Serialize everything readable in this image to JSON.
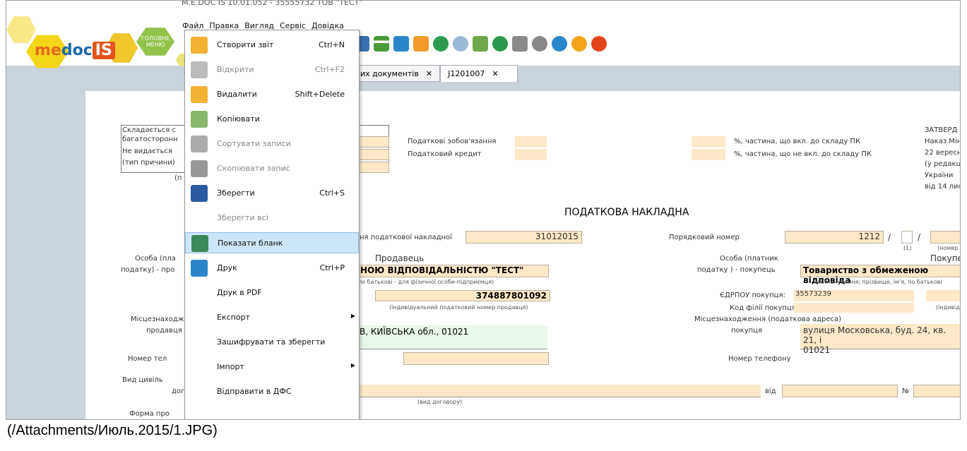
{
  "window": {
    "title": "M.E.DOC IS 10.01.052 - 35555732 ТОВ \"ТЕСТ\""
  },
  "menubar": [
    "Файл",
    "Правка",
    "Вигляд",
    "Сервіс",
    "Довідка"
  ],
  "logo": {
    "part1": "me",
    "part2": "doc",
    "part3": "IS"
  },
  "home_button": {
    "line1": "ГОЛОВНЕ",
    "line2": "МЕНЮ"
  },
  "tabs": [
    {
      "label": "их документів",
      "close": "✕"
    },
    {
      "label": "J1201007",
      "close": "✕"
    }
  ],
  "file_menu": [
    {
      "label": "Створити звіт",
      "shortcut": "Ctrl+N",
      "icon": "create-report-icon",
      "disabled": false
    },
    {
      "label": "Відкрити",
      "shortcut": "Ctrl+F2",
      "icon": "open-folder-icon",
      "disabled": true
    },
    {
      "label": "Видалити",
      "shortcut": "Shift+Delete",
      "icon": "delete-folder-icon",
      "disabled": false
    },
    {
      "label": "Копіювати",
      "shortcut": "",
      "icon": "copy-icon",
      "disabled": false
    },
    {
      "label": "Сортувати записи",
      "shortcut": "",
      "icon": "sort-icon",
      "disabled": true
    },
    {
      "label": "Скопіювати запис",
      "shortcut": "",
      "icon": "copy-record-icon",
      "disabled": true
    },
    {
      "label": "Зберегти",
      "shortcut": "Ctrl+S",
      "icon": "save-icon",
      "disabled": false
    },
    {
      "label": "Зберегти всі",
      "shortcut": "",
      "icon": "",
      "disabled": true
    },
    {
      "label": "Показати бланк",
      "shortcut": "",
      "icon": "show-form-icon",
      "disabled": false,
      "highlighted": true
    },
    {
      "label": "Друк",
      "shortcut": "Ctrl+P",
      "icon": "print-icon",
      "disabled": false
    },
    {
      "label": "Друк в PDF",
      "shortcut": "",
      "icon": "",
      "disabled": false
    },
    {
      "label": "Експорт",
      "shortcut": "",
      "icon": "",
      "disabled": false,
      "submenu": true
    },
    {
      "label": "Зашифрувати та зберегти",
      "shortcut": "",
      "icon": "",
      "disabled": false
    },
    {
      "label": "Імпорт",
      "shortcut": "",
      "icon": "",
      "disabled": false,
      "submenu": true
    },
    {
      "label": "Відправити в ДФС",
      "shortcut": "",
      "icon": "",
      "disabled": false
    }
  ],
  "doc": {
    "left_box": [
      "Складається с",
      "багатосторонн",
      "Не видається",
      "(тип причини)",
      "(п"
    ],
    "tax_liab": "Податкові зобов'язання",
    "tax_credit": "Податковий кредит",
    "pct_incl": "%, частина, що вкл. до складу ПК",
    "pct_excl": "%, частина, що не вкл. до складу ПК",
    "approved": [
      "ЗАТВЕРД",
      "Наказ Мін",
      "22 вересн",
      "(у редакці",
      "України",
      "від 14 лис"
    ],
    "title": "ПОДАТКОВА НАКЛАДНА",
    "date_label": "ня податкової накладної",
    "date_value": "31012015",
    "seq_label": "Порядковий номер",
    "seq_value": "1212",
    "seq_sep": "/",
    "seq_sub": "(1)",
    "branch_sub": "(номер філ",
    "seller_head": "Продавець",
    "buyer_head": "Покупець",
    "person_left": [
      "Особа (пла",
      "податку) - про"
    ],
    "person_right": [
      "Особа (платник",
      "податку ) - покупець"
    ],
    "seller_name": "НОЮ ВІДПОВІДАЛЬНІСТЮ \"ТЕСТ\"",
    "seller_sub": "по батькові - для фізичної особи-підприємця)",
    "buyer_name": "Товариство з обмеженою відповіда",
    "buyer_sub": "(найменування; прізвище, ім'я, по батькові",
    "ipn": "374887801092",
    "ipn_sub": "(індивідуальний податковий номер продавця)",
    "edrpou_label": "ЄДРПОУ покупця:",
    "edrpou_value": "35573239",
    "branch_label": "Код філії покупця:",
    "indiv_sub": "(індивід",
    "loc_left": [
      "Місцезнаходж",
      "продавця"
    ],
    "loc_right_head": "Місцезнаходження (податкова адреса)",
    "loc_right_label": "покупця",
    "seller_addr": "В, КИЇВСЬКА обл., 01021",
    "buyer_addr": [
      "вулиця Московська, буд. 24, кв. 21, і",
      "01021"
    ],
    "phone_left": "Номер тел",
    "phone_right": "Номер телефону",
    "contract_left": [
      "Вид цивіль",
      "дог"
    ],
    "contract_from": "від",
    "contract_no": "№",
    "contract_sub": "(вид договору)",
    "payment_form": "Форма про"
  },
  "caption": "(/Attachments/Июль.2015/1.JPG)"
}
